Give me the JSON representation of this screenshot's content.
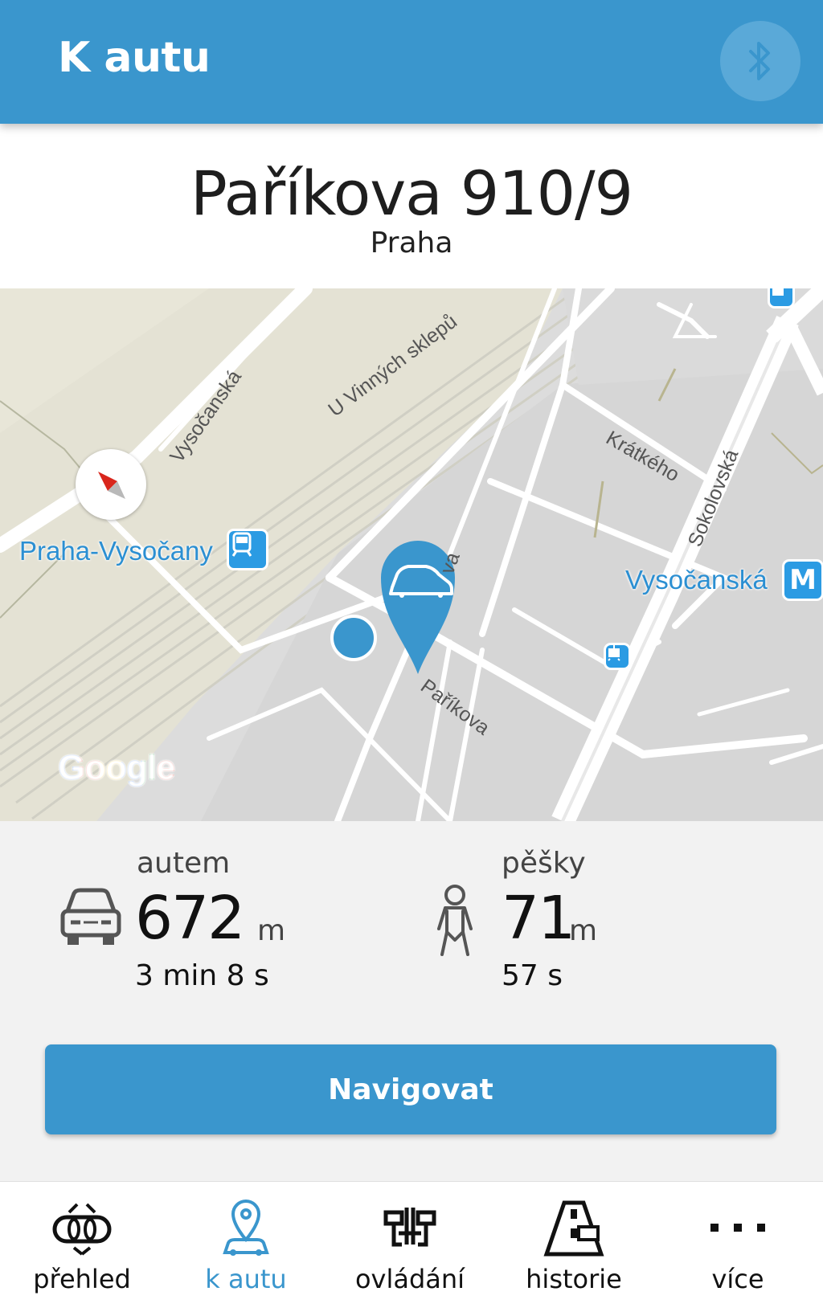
{
  "header": {
    "title": "K autu",
    "bluetooth_icon": "bluetooth-icon"
  },
  "address": {
    "street": "Paříkova 910/9",
    "city": "Praha"
  },
  "map": {
    "labels": {
      "vysocanska_street": "Vysočanská",
      "u_vinnych_sklepu": "U Vinných sklepů",
      "kratkeho": "Krátkého",
      "sokolovska": "Sokolovská",
      "parikova": "Paříkova",
      "va_fragment": "va"
    },
    "poi": {
      "station": "Praha-Vysočany",
      "metro": "Vysočanská",
      "metro_badge": "M"
    },
    "attribution": "Google",
    "colors": {
      "pin": "#3a96cd",
      "poi": "#2b8fd2"
    }
  },
  "distances": {
    "car": {
      "label": "autem",
      "value": "672",
      "unit": "m",
      "time": "3 min 8 s",
      "icon": "car-icon"
    },
    "walk": {
      "label": "pěšky",
      "value": "71",
      "unit": "m",
      "time": "57 s",
      "icon": "pedestrian-icon"
    }
  },
  "actions": {
    "navigate_label": "Navigovat"
  },
  "bottom_nav": {
    "items": [
      {
        "label": "přehled",
        "icon": "overview-icon",
        "active": false
      },
      {
        "label": "k autu",
        "icon": "car-location-icon",
        "active": true
      },
      {
        "label": "ovládání",
        "icon": "controls-icon",
        "active": false
      },
      {
        "label": "historie",
        "icon": "road-history-icon",
        "active": false
      },
      {
        "label": "více",
        "icon": "more-icon",
        "active": false
      }
    ]
  },
  "colors": {
    "primary": "#3a96cd",
    "background": "#f2f2f2"
  }
}
